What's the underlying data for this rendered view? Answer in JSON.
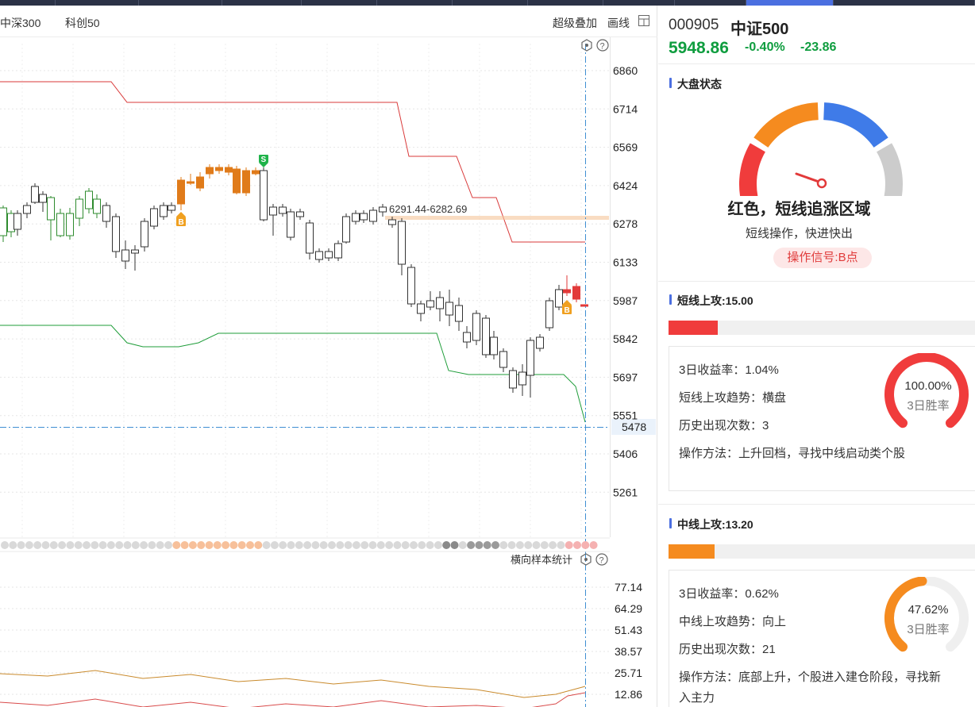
{
  "toolbar": {
    "tab_hs300": "中深300",
    "tab_kc50": "科创50",
    "overlay": "超级叠加",
    "draw": "画线"
  },
  "chart": {
    "price_ticks": [
      "6860",
      "6714",
      "6569",
      "6424",
      "6278",
      "6133",
      "5987",
      "5842",
      "5697",
      "5551",
      "5406",
      "5261"
    ],
    "crosshair_value": "5478",
    "range_label": "6291.44-6282.69",
    "buy_marker": "B",
    "sell_marker": "S",
    "lower_label": "横向样本统计",
    "lower_ticks": [
      "77.14",
      "64.29",
      "51.43",
      "38.57",
      "25.71",
      "12.86"
    ],
    "colors": {
      "up": "#2e8b2e",
      "down": "#333333",
      "signal_up": "#e07b1a",
      "upper_band": "#d93a3a",
      "lower_band": "#1f9d3a",
      "crosshair": "#3f8fd2"
    }
  },
  "panel": {
    "code": "000905",
    "name": "中证500",
    "price": "5948.86",
    "pct": "-0.40%",
    "change": "-23.86",
    "market_state": {
      "title": "大盘状态",
      "state": "红色，短线追涨区域",
      "advice": "短线操作，快进快出",
      "signal": "操作信号:B点",
      "colors": [
        "#f03c3c",
        "#f58b1f",
        "#3f7be8",
        "#cccccc"
      ]
    },
    "short": {
      "title": "短线上攻:15.00",
      "progress": 0.16,
      "color": "#f03c3c",
      "return_label": "3日收益率：1.04%",
      "trend_label": "短线上攻趋势：横盘",
      "count_label": "历史出现次数：3",
      "method_label": "操作方法：上升回档，寻找中线启动类个股",
      "win_rate": "100.00%",
      "win_rate_value": 1.0,
      "win_label": "3日胜率"
    },
    "mid": {
      "title": "中线上攻:13.20",
      "progress": 0.15,
      "color": "#f58b1f",
      "return_label": "3日收益率：0.62%",
      "trend_label": "中线上攻趋势：向上",
      "count_label": "历史出现次数：21",
      "method_label": "操作方法：底部上升，个股进入建仓阶段，寻找新",
      "method_label_2": "入主力",
      "win_rate": "47.62%",
      "win_rate_value": 0.4762,
      "win_label": "3日胜率"
    }
  }
}
